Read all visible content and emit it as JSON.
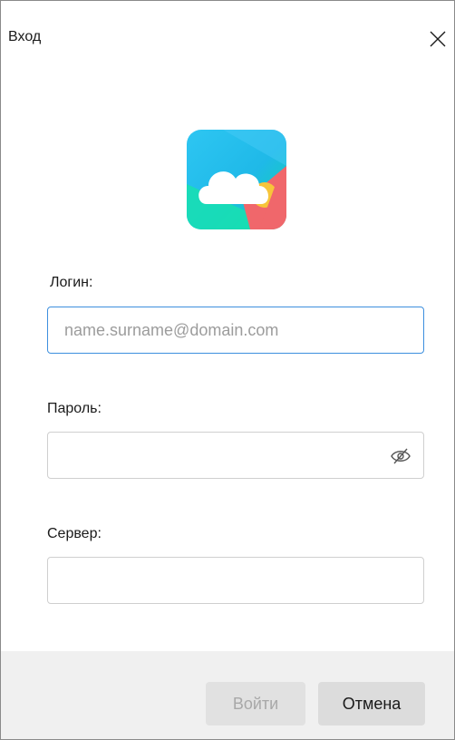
{
  "window": {
    "title": "Вход"
  },
  "icons": {
    "close": "close-icon",
    "logo": "cloud-logo",
    "eye": "eye-slash-icon"
  },
  "form": {
    "login_label": "Логин:",
    "login_placeholder": "name.surname@domain.com",
    "login_value": "",
    "password_label": "Пароль:",
    "password_value": "",
    "server_label": "Сервер:",
    "server_value": ""
  },
  "buttons": {
    "login": "Войти",
    "cancel": "Отмена"
  },
  "colors": {
    "focus_border": "#3d8fde",
    "footer_bg": "#f0f0f0",
    "disabled_text": "#a8a8a8"
  }
}
